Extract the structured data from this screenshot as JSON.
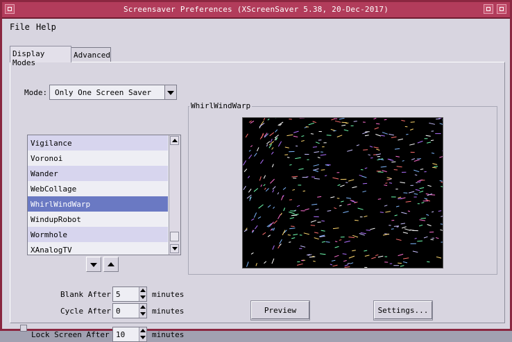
{
  "window": {
    "title": "Screensaver Preferences  (XScreenSaver 5.38, 20-Dec-2017)"
  },
  "menu": {
    "file": "File",
    "help": "Help"
  },
  "tabs": {
    "display_modes": "Display Modes",
    "advanced": "Advanced"
  },
  "mode": {
    "label": "Mode:",
    "value": "Only One Screen Saver"
  },
  "savers": [
    "Vigilance",
    "Voronoi",
    "Wander",
    "WebCollage",
    "WhirlWindWarp",
    "WindupRobot",
    "Wormhole",
    "XAnalogTV"
  ],
  "selected_saver": "WhirlWindWarp",
  "preview_frame": {
    "title": "WhirlWindWarp"
  },
  "blank_after": {
    "label": "Blank After",
    "value": "5",
    "unit": "minutes"
  },
  "cycle_after": {
    "label": "Cycle After",
    "value": "0",
    "unit": "minutes"
  },
  "lock_screen": {
    "label": "Lock Screen After",
    "value": "10",
    "unit": "minutes",
    "checked": false
  },
  "buttons": {
    "preview": "Preview",
    "settings": "Settings..."
  },
  "colors": {
    "title_bar": "#b23c5b",
    "selection": "#6a79c3",
    "row_alt": "#d7d5ee",
    "background": "#d8d5e0"
  },
  "icons": {
    "move_down": "arrow-down-icon",
    "move_up": "arrow-up-icon",
    "combo": "chevron-down-icon"
  }
}
